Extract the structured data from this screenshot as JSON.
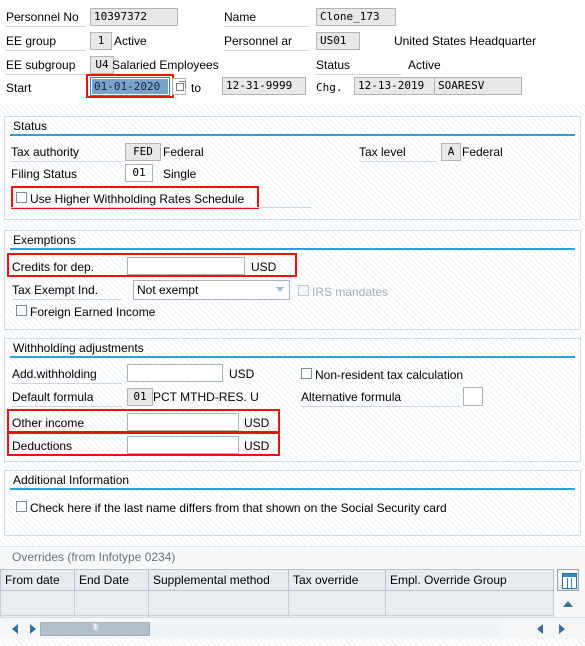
{
  "header": {
    "fields": [
      {
        "label": "Personnel No",
        "value": "10397372"
      },
      {
        "label": "Name",
        "value": "Clone_173"
      },
      {
        "label": "EE group",
        "value": "1",
        "text": "Active"
      },
      {
        "label": "Personnel ar",
        "value": "US01",
        "text": "United States Headquarter"
      },
      {
        "label": "EE subgroup",
        "value": "U4",
        "text": "Salaried Employees"
      },
      {
        "label": "Status",
        "value": "",
        "text": "Active"
      }
    ],
    "validity": {
      "start_label": "Start",
      "start_value": "01-01-2020",
      "to_label": "to",
      "end_value": "12-31-9999",
      "chg_label": "Chg.",
      "chg_date": "12-13-2019",
      "chg_user": "SOARESV"
    }
  },
  "status_group": {
    "title": "Status",
    "tax_authority_label": "Tax authority",
    "tax_authority_code": "FED",
    "tax_authority_text": "Federal",
    "tax_level_label": "Tax level",
    "tax_level_code": "A",
    "tax_level_text": "Federal",
    "filing_status_label": "Filing Status",
    "filing_status_code": "01",
    "filing_status_text": "Single",
    "higher_rates_label": "Use Higher Withholding Rates Schedule"
  },
  "exemptions_group": {
    "title": "Exemptions",
    "credits_label": "Credits for dep.",
    "credits_value": "",
    "credits_currency": "USD",
    "tax_exempt_label": "Tax Exempt Ind.",
    "tax_exempt_value": "Not exempt",
    "irs_mandates_label": "IRS mandates",
    "foreign_income_label": "Foreign Earned Income"
  },
  "withholding_group": {
    "title": "Withholding adjustments",
    "add_withholding_label": "Add.withholding",
    "add_withholding_value": "",
    "add_withholding_currency": "USD",
    "nonresident_label": "Non-resident tax calculation",
    "default_formula_label": "Default formula",
    "default_formula_code": "01",
    "default_formula_text": "PCT MTHD-RES. U",
    "alternative_formula_label": "Alternative formula",
    "alternative_formula_value": "",
    "other_income_label": "Other income",
    "other_income_value": "",
    "other_income_currency": "USD",
    "deductions_label": "Deductions",
    "deductions_value": "",
    "deductions_currency": "USD"
  },
  "additional_group": {
    "title": "Additional Information",
    "lastname_differs_label": "Check here if the last name differs from that shown on the Social Security card"
  },
  "overrides": {
    "caption": "Overrides (from Infotype 0234)",
    "columns": [
      "From date",
      "End Date",
      "Supplemental method",
      "Tax override",
      "Empl. Override Group"
    ],
    "rows": [
      [
        "",
        "",
        "",
        "",
        ""
      ],
      [
        "",
        "",
        "",
        "",
        ""
      ]
    ]
  },
  "icons": {
    "f4_help": "value-help-icon",
    "table_settings": "table-settings-icon",
    "scroll_up": "chevron-up-icon",
    "scroll_down": "chevron-down-icon",
    "scroll_left": "chevron-left-icon",
    "scroll_right": "chevron-right-icon",
    "dropdown": "chevron-down-icon"
  },
  "colors": {
    "accent": "#2aa3d8",
    "highlight": "#ee1111",
    "focus": "#2f7fc4",
    "selection": "#7aa3cc"
  }
}
